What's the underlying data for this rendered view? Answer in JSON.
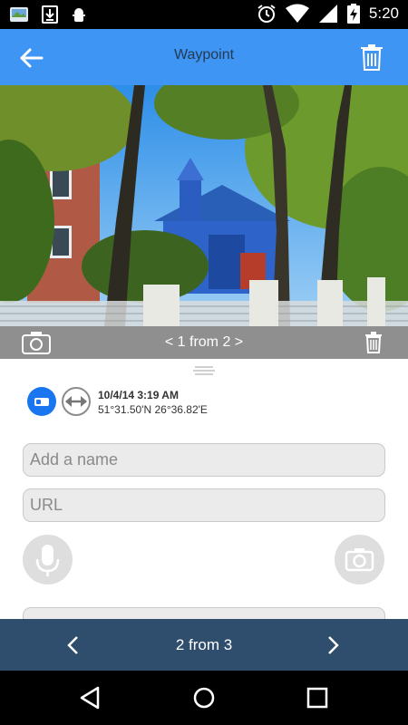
{
  "status_bar": {
    "time": "5:20",
    "left_icons": [
      "gallery-icon",
      "download-icon",
      "android-debug-icon"
    ],
    "right_icons": [
      "alarm-icon",
      "wifi-icon",
      "signal-icon",
      "battery-charging-icon"
    ]
  },
  "toolbar": {
    "title": "Waypoint",
    "back_icon": "arrow-back-icon",
    "delete_icon": "trash-icon",
    "color": "#3e95f3"
  },
  "photo_bar": {
    "counter": "< 1 from 2 >",
    "camera_icon": "camera-icon",
    "delete_icon": "trash-icon"
  },
  "waypoint": {
    "datetime": "10/4/14 3:19 AM",
    "coordinates": "51°31.50'N 26°36.82'E"
  },
  "form": {
    "name_placeholder": "Add a name",
    "name_value": "",
    "url_placeholder": "URL",
    "url_value": ""
  },
  "bottom_nav": {
    "label": "2 from 3",
    "color": "#2f4d6d"
  },
  "system_nav": [
    "back-icon",
    "home-icon",
    "recents-icon"
  ]
}
